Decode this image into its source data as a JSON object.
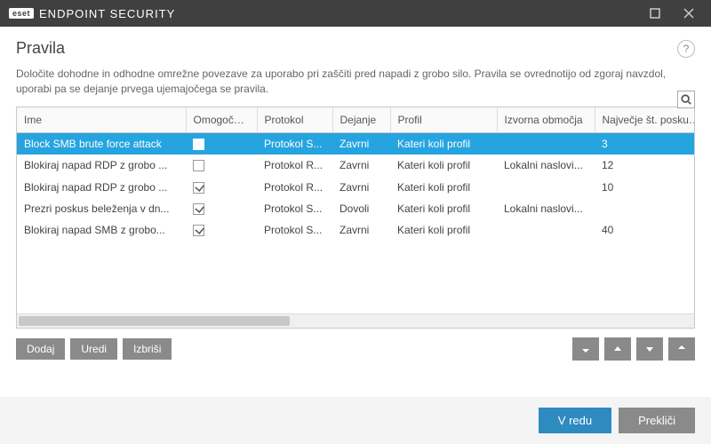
{
  "titlebar": {
    "brand_small": "eset",
    "brand_main": "ENDPOINT SECURITY"
  },
  "header": {
    "title": "Pravila",
    "help": "?"
  },
  "description": "Določite dohodne in odhodne omrežne povezave za uporabo pri zaščiti pred napadi z grobo silo. Pravila se ovrednotijo od zgoraj navzdol, uporabi pa se dejanje prvega ujemajočega se pravila.",
  "columns": {
    "name": "Ime",
    "enabled": "Omogočeno",
    "protocol": "Protokol",
    "action": "Dejanje",
    "profile": "Profil",
    "source": "Izvorna območja",
    "max": "Največje št. poskusov"
  },
  "rows": [
    {
      "name": "Block SMB brute force attack",
      "enabled": false,
      "protocol": "Protokol S...",
      "action": "Zavrni",
      "profile": "Kateri koli profil",
      "source": "",
      "max": "3",
      "selected": true
    },
    {
      "name": "Blokiraj napad RDP z grobo ...",
      "enabled": false,
      "protocol": "Protokol R...",
      "action": "Zavrni",
      "profile": "Kateri koli profil",
      "source": "Lokalni naslovi...",
      "max": "12",
      "selected": false
    },
    {
      "name": "Blokiraj napad RDP z grobo ...",
      "enabled": true,
      "protocol": "Protokol R...",
      "action": "Zavrni",
      "profile": "Kateri koli profil",
      "source": "",
      "max": "10",
      "selected": false
    },
    {
      "name": "Prezri poskus beleženja v dn...",
      "enabled": true,
      "protocol": "Protokol S...",
      "action": "Dovoli",
      "profile": "Kateri koli profil",
      "source": "Lokalni naslovi...",
      "max": "",
      "selected": false
    },
    {
      "name": "Blokiraj napad SMB z grobo...",
      "enabled": true,
      "protocol": "Protokol S...",
      "action": "Zavrni",
      "profile": "Kateri koli profil",
      "source": "",
      "max": "40",
      "selected": false
    }
  ],
  "buttons": {
    "add": "Dodaj",
    "edit": "Uredi",
    "delete": "Izbriši",
    "ok": "V redu",
    "cancel": "Prekliči"
  }
}
